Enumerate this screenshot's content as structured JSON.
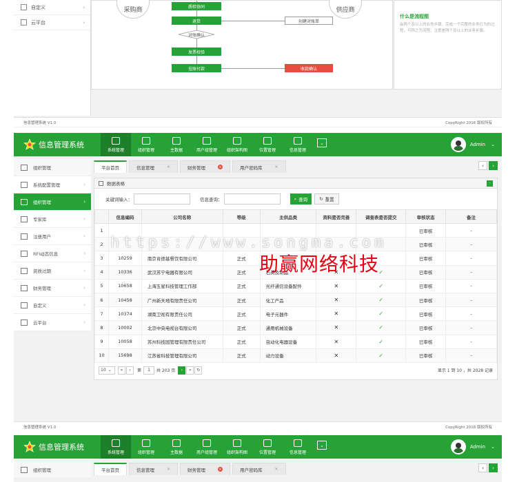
{
  "top_fragment": {
    "sidebar_items": [
      "自定义",
      "云平台"
    ],
    "buyer": "采购商",
    "supplier": "供应商",
    "flow_steps": [
      "质检协同",
      "退货",
      "对账确认",
      "发票校验",
      "挂账付款"
    ],
    "create_statement": "创建对账单",
    "receipt_confirm": "收款确认",
    "info_title": "什么是流程图",
    "info_text": "由两个及以上的业务步骤，完成一个完整的业务行为的过程，可称之为流程；注意是两个及以上的业务步骤。",
    "footer_left": "信息管理系统 V1.0",
    "footer_right": "CopyRight 2016   版权所有"
  },
  "app": {
    "title": "信息管理系统",
    "nav": [
      "系统管理",
      "组织管理",
      "主数据",
      "用户组管理",
      "组织架构图",
      "位置管理",
      "信息管理"
    ],
    "user": "Admin",
    "sidebar": [
      {
        "label": "组织管理"
      },
      {
        "label": "系统配置管理"
      },
      {
        "label": "组织管理"
      },
      {
        "label": "专家库"
      },
      {
        "label": "注册用户"
      },
      {
        "label": "RFI动态信息"
      },
      {
        "label": "资质过期"
      },
      {
        "label": "财务管理"
      },
      {
        "label": "自定义"
      },
      {
        "label": "云平台"
      }
    ],
    "tabs": [
      {
        "label": "平台首页"
      },
      {
        "label": "信息管理"
      },
      {
        "label": "财务管理"
      },
      {
        "label": "用户密码库"
      }
    ],
    "panel_title": "数据表格",
    "search": {
      "keyword_label": "关键词输入：",
      "info_label": "信息查询：",
      "query_btn": "查询",
      "reset_btn": "重置"
    },
    "table": {
      "headers": [
        "",
        "信息编码",
        "公司名称",
        "等级",
        "主供品类",
        "资料是否完善",
        "调查表是否提交",
        "审核状态",
        "备注"
      ],
      "rows": [
        {
          "no": "1",
          "code": "",
          "company": "",
          "level": "",
          "category": "",
          "complete": "",
          "submitted": "",
          "status": "已审核",
          "note": "-"
        },
        {
          "no": "2",
          "code": "",
          "company": "",
          "level": "",
          "category": "",
          "complete": "",
          "submitted": "",
          "status": "已审核",
          "note": "-"
        },
        {
          "no": "3",
          "code": "10259",
          "company": "南京肯德基餐饮有限公司",
          "level": "正式",
          "category": "",
          "complete": "",
          "submitted": "",
          "status": "已审核",
          "note": "-"
        },
        {
          "no": "4",
          "code": "10336",
          "company": "武汉苏宁电器有限公司",
          "level": "正式",
          "category": "石英及制品",
          "complete": "✕",
          "submitted": "✓",
          "status": "已审核",
          "note": "-"
        },
        {
          "no": "5",
          "code": "10658",
          "company": "上海五星科技管理工作部",
          "level": "正式",
          "category": "光纤通信设备配件",
          "complete": "✕",
          "submitted": "✓",
          "status": "已审核",
          "note": "-"
        },
        {
          "no": "6",
          "code": "10458",
          "company": "广州新天地有限责任公司",
          "level": "正式",
          "category": "化工产品",
          "complete": "✕",
          "submitted": "✓",
          "status": "已审核",
          "note": "-"
        },
        {
          "no": "7",
          "code": "10374",
          "company": "湖南卫视有限责任公司",
          "level": "正式",
          "category": "电子元器件",
          "complete": "✕",
          "submitted": "✓",
          "status": "已审核",
          "note": "-"
        },
        {
          "no": "8",
          "code": "10002",
          "company": "北京中央电视台有限公司",
          "level": "正式",
          "category": "通用机械设备",
          "complete": "✕",
          "submitted": "✓",
          "status": "已审核",
          "note": "-"
        },
        {
          "no": "9",
          "code": "10058",
          "company": "苏州科技园管理有限责任公司",
          "level": "正式",
          "category": "自动化电器设备",
          "complete": "✕",
          "submitted": "✓",
          "status": "已审核",
          "note": "-"
        },
        {
          "no": "10",
          "code": "15698",
          "company": "江苏省科技管理有限公司",
          "level": "正式",
          "category": "动力设备",
          "complete": "✕",
          "submitted": "✓",
          "status": "已审核",
          "note": "-"
        }
      ]
    },
    "pager": {
      "page_size": "10",
      "page_prefix": "第",
      "page_num": "1",
      "page_suffix": "共 203 页",
      "info": "显示 1 到 10 ，共 2028 记录"
    },
    "footer_left": "信息管理系统 V1.0",
    "footer_right": "CopyRight 2016   版权所有"
  },
  "watermark": {
    "url": "https://www.songma.com",
    "brand": "助赢网络科技"
  },
  "colors": {
    "primary": "#27a236",
    "dark": "#1d7f28",
    "red": "#e74c3c"
  }
}
